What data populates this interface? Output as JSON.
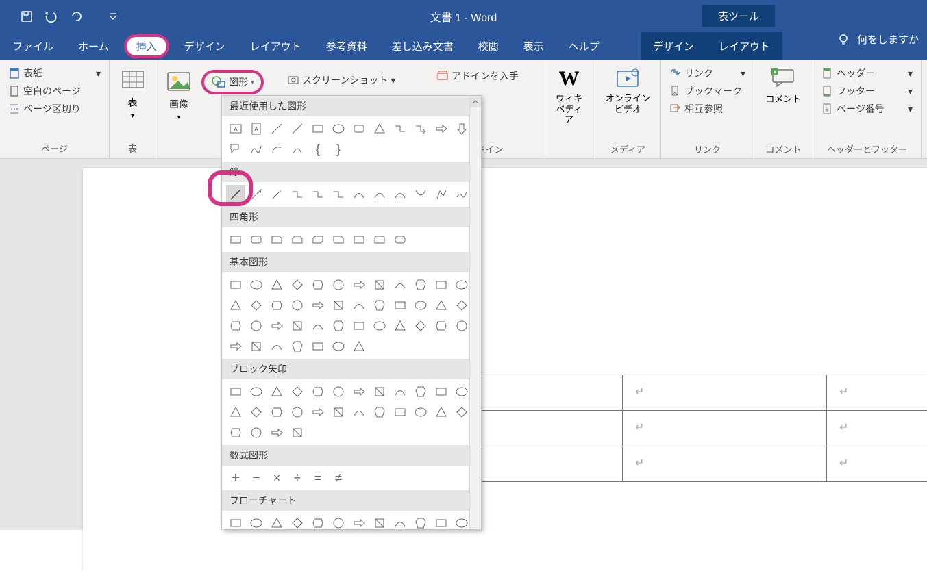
{
  "title": "文書 1  -  Word",
  "context_tool": "表ツール",
  "qat": {
    "save": "save",
    "undo": "undo",
    "redo": "redo"
  },
  "tabs": {
    "file": "ファイル",
    "home": "ホーム",
    "insert": "挿入",
    "design": "デザイン",
    "layout": "レイアウト",
    "references": "参考資料",
    "mailmerge": "差し込み文書",
    "review": "校閲",
    "view": "表示",
    "help": "ヘルプ",
    "ctx_design": "デザイン",
    "ctx_layout": "レイアウト",
    "tellme": "何をしますか"
  },
  "ribbon": {
    "pages": {
      "label": "ページ",
      "cover": "表紙",
      "blank": "空白のページ",
      "break": "ページ区切り"
    },
    "tables": {
      "label": "表",
      "button": "表"
    },
    "images": {
      "label": "画像"
    },
    "shapes": {
      "label": "図形"
    },
    "screenshot": "スクリーンショット",
    "addins": {
      "label": "アドイン",
      "get": "アドインを入手",
      "my": "アドイン"
    },
    "wiki": {
      "label": "ウィキペディア"
    },
    "media": {
      "label": "メディア",
      "video": "オンライン\nビデオ"
    },
    "links": {
      "label": "リンク",
      "link": "リンク",
      "bookmark": "ブックマーク",
      "crossref": "相互参照"
    },
    "comments": {
      "label": "コメント",
      "button": "コメント"
    },
    "headerfooter": {
      "label": "ヘッダーとフッター",
      "header": "ヘッダー",
      "footer": "フッター",
      "pagenum": "ページ番号"
    }
  },
  "shapes_panel": {
    "recent": "最近使用した図形",
    "lines": "線",
    "rects": "四角形",
    "basic": "基本図形",
    "arrows": "ブロック矢印",
    "equation": "数式図形",
    "flowchart": "フローチャート"
  },
  "table_cells": {
    "mark": "↵"
  }
}
